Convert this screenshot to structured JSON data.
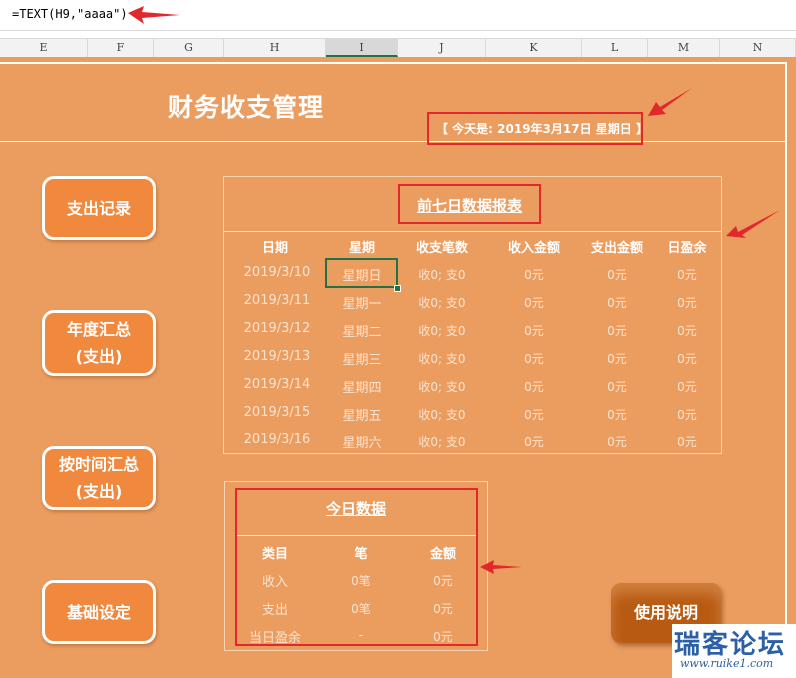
{
  "formula_bar": {
    "text": "=TEXT(H9,\"aaaa\")"
  },
  "columns": [
    "E",
    "F",
    "G",
    "H",
    "I",
    "J",
    "K",
    "L",
    "M",
    "N"
  ],
  "selected_column": "I",
  "header": {
    "title": "财务收支管理",
    "today": "【 今天是: 2019年3月17日 星期日 】"
  },
  "side_buttons": [
    {
      "lines": [
        "支出记录"
      ]
    },
    {
      "lines": [
        "年度汇总",
        "(支出)"
      ]
    },
    {
      "lines": [
        "按时间汇总",
        "(支出)"
      ]
    },
    {
      "lines": [
        "基础设定"
      ]
    }
  ],
  "report": {
    "title": "前七日数据报表",
    "headers": [
      "日期",
      "星期",
      "收支笔数",
      "收入金额",
      "支出金额",
      "日盈余"
    ],
    "rows": [
      [
        "2019/3/10",
        "星期日",
        "收0; 支0",
        "0元",
        "0元",
        "0元"
      ],
      [
        "2019/3/11",
        "星期一",
        "收0; 支0",
        "0元",
        "0元",
        "0元"
      ],
      [
        "2019/3/12",
        "星期二",
        "收0; 支0",
        "0元",
        "0元",
        "0元"
      ],
      [
        "2019/3/13",
        "星期三",
        "收0; 支0",
        "0元",
        "0元",
        "0元"
      ],
      [
        "2019/3/14",
        "星期四",
        "收0; 支0",
        "0元",
        "0元",
        "0元"
      ],
      [
        "2019/3/15",
        "星期五",
        "收0; 支0",
        "0元",
        "0元",
        "0元"
      ],
      [
        "2019/3/16",
        "星期六",
        "收0; 支0",
        "0元",
        "0元",
        "0元"
      ]
    ]
  },
  "today_data": {
    "title": "今日数据",
    "headers": [
      "类目",
      "笔",
      "金额"
    ],
    "rows": [
      [
        "收入",
        "0笔",
        "0元"
      ],
      [
        "支出",
        "0笔",
        "0元"
      ],
      [
        "当日盈余",
        "-",
        "0元"
      ]
    ]
  },
  "help_button": {
    "label": "使用说明"
  },
  "watermark": {
    "title": "瑞客论坛",
    "url": "www.ruike1.com"
  },
  "colors": {
    "sheet_bg": "#eb9c5f",
    "button": "#f0883d",
    "highlight": "#e1282d",
    "excel_green": "#217346"
  }
}
